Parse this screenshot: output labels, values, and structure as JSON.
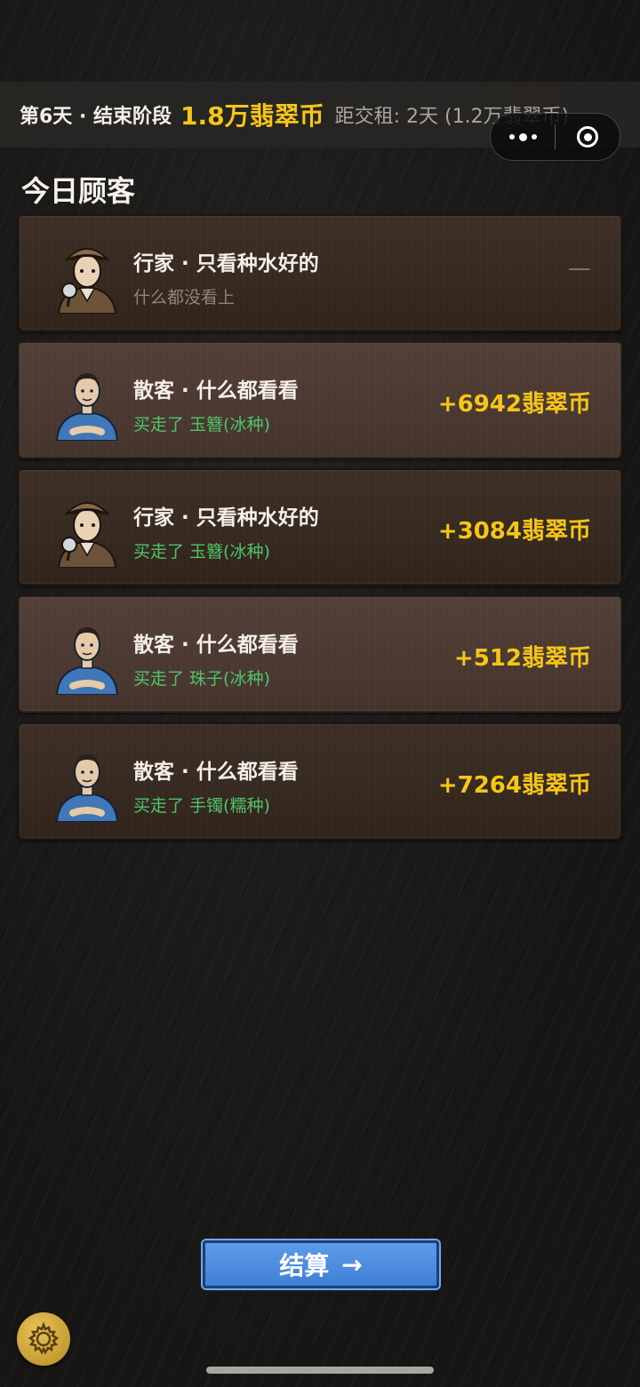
{
  "status": {
    "day_phase": "第6天 · 结束阶段",
    "coins": "1.8万翡翠币",
    "rent": "距交租: 2天 (1.2万翡翠币)"
  },
  "capsule": {
    "more_icon": "more-dots-icon",
    "close_icon": "target-close-icon"
  },
  "section_title": "今日顾客",
  "customers": [
    {
      "avatar": "detective",
      "name": "行家 · 只看种水好的",
      "result": "什么都没看上",
      "amount": "—",
      "bought": false
    },
    {
      "avatar": "casual",
      "name": "散客 · 什么都看看",
      "result": "买走了  玉簪(冰种)",
      "amount": "+6942翡翠币",
      "bought": true
    },
    {
      "avatar": "detective",
      "name": "行家 · 只看种水好的",
      "result": "买走了  玉簪(冰种)",
      "amount": "+3084翡翠币",
      "bought": true
    },
    {
      "avatar": "casual",
      "name": "散客 · 什么都看看",
      "result": "买走了  珠子(冰种)",
      "amount": "+512翡翠币",
      "bought": true
    },
    {
      "avatar": "casual",
      "name": "散客 · 什么都看看",
      "result": "买走了  手镯(糯种)",
      "amount": "+7264翡翠币",
      "bought": true
    }
  ],
  "checkout": {
    "label": "结算",
    "arrow": "→"
  },
  "settings_icon": "gear-icon",
  "colors": {
    "coin": "#f5c518",
    "bought": "#4fc46a",
    "button": "#4a8ae0"
  }
}
